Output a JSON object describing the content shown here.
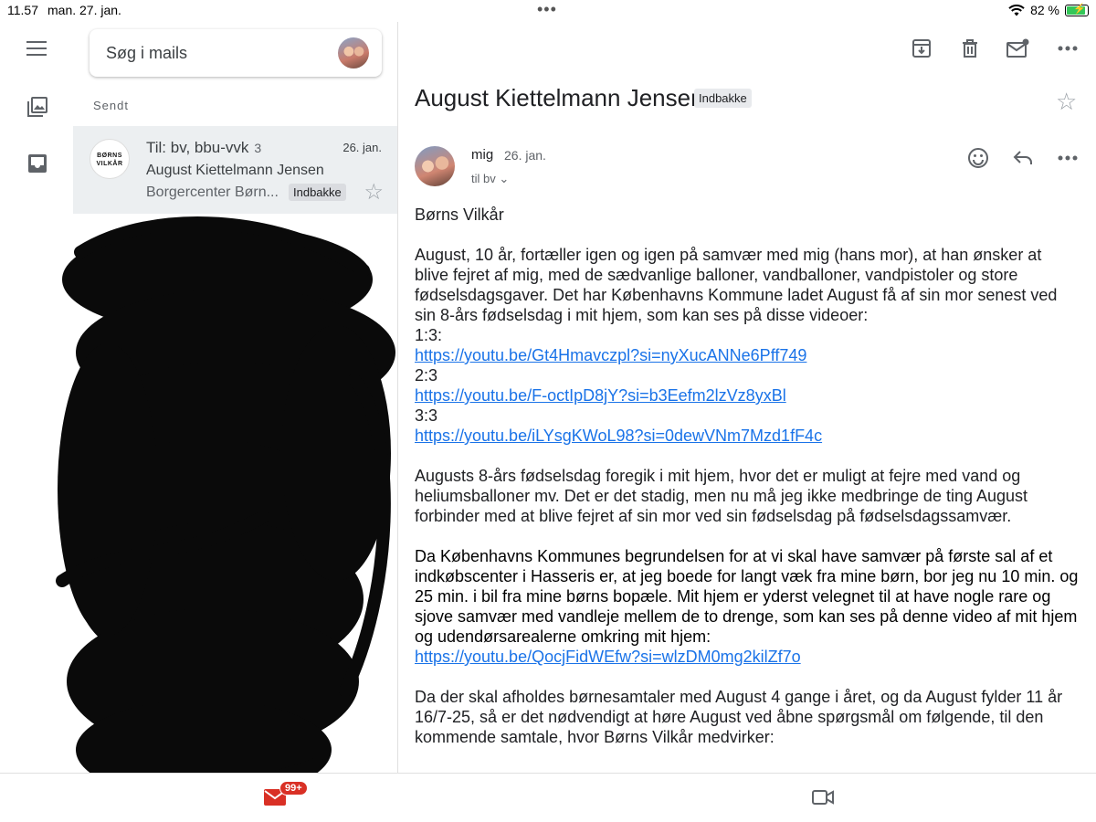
{
  "status_bar": {
    "time": "11.57",
    "date": "man. 27. jan.",
    "battery": "82 %",
    "battery_level": 0.82
  },
  "search": {
    "placeholder": "Søg i mails"
  },
  "mailbox": {
    "section": "Sendt"
  },
  "selected_mail": {
    "to": "Til: bv, bbu-vvk",
    "count": "3",
    "date": "26. jan.",
    "subject": "August Kiettelmann Jensen",
    "snippet": "Borgercenter Børn...",
    "label": "Indbakke",
    "logo_text": "BØRNS VILKÅR"
  },
  "message": {
    "subject": "August Kiettelmann Jensen",
    "label": "Indbakke",
    "from": "mig",
    "date": "26. jan.",
    "to": "til bv",
    "greeting": "Børns Vilkår",
    "p1": [
      "August, 10 år, fortæller igen og igen på samvær med mig (hans mor), at han ønsker at",
      "blive fejret af mig, med de sædvanlige balloner, vandballoner, vandpistoler og store",
      "fødselsdagsgaver. Det har Københavns Kommune ladet August få af sin mor senest ved",
      "sin 8-års fødselsdag i mit hjem, som kan ses på disse videoer:"
    ],
    "videos": [
      {
        "label": "1:3:",
        "url": "https://youtu.be/Gt4Hmavczpl?si=nyXucANNe6Pff749"
      },
      {
        "label": "2:3",
        "url": "https://youtu.be/F-octIpD8jY?si=b3Eefm2lzVz8yxBl"
      },
      {
        "label": "3:3",
        "url": "https://youtu.be/iLYsgKWoL98?si=0dewVNm7Mzd1fF4c"
      }
    ],
    "p2": [
      "Augusts 8-års fødselsdag foregik i mit hjem, hvor det er muligt at fejre med vand og",
      "heliumsballoner mv. Det er det stadig, men nu må jeg ikke medbringe de ting August",
      "forbinder med at blive fejret af sin mor ved sin fødselsdag på fødselsdagssamvær."
    ],
    "p3": [
      "Da Københavns Kommunes begrundelsen for at vi skal have samvær på første sal af et",
      "indkøbscenter i Hasseris er, at jeg boede for langt væk fra mine børn, bor jeg nu 10 min. og",
      "25 min. i bil fra mine børns bopæle. Mit hjem er yderst velegnet til at have nogle rare og",
      "sjove samvær med vandleje mellem de to drenge, som kan ses på denne video af mit hjem",
      "og udendørsarealerne omkring mit hjem:"
    ],
    "p3_url": "https://youtu.be/QocjFidWEfw?si=wlzDM0mg2kilZf7o",
    "p4": [
      "Da der skal afholdes børnesamtaler med August 4 gange i året, og da August fylder 11 år",
      "16/7-25, så er det nødvendigt at høre August ved åbne spørgsmål om følgende, til den",
      "kommende samtale, hvor Børns Vilkår medvirker:"
    ]
  },
  "bottom_nav": {
    "mail_badge": "99+"
  },
  "icons": {
    "menu": "menu-icon",
    "photos": "photos-icon",
    "inbox": "inbox-icon",
    "archive": "archive-icon",
    "delete": "trash-icon",
    "mark_unread": "mark-unread-icon",
    "more": "more-icon",
    "emoji": "emoji-icon",
    "reply": "reply-icon",
    "star": "star-icon",
    "wifi": "wifi-icon",
    "meet": "video-icon"
  },
  "colors": {
    "accent_red": "#d93025",
    "link_blue": "#1a73e8",
    "battery_green": "#34c759"
  }
}
